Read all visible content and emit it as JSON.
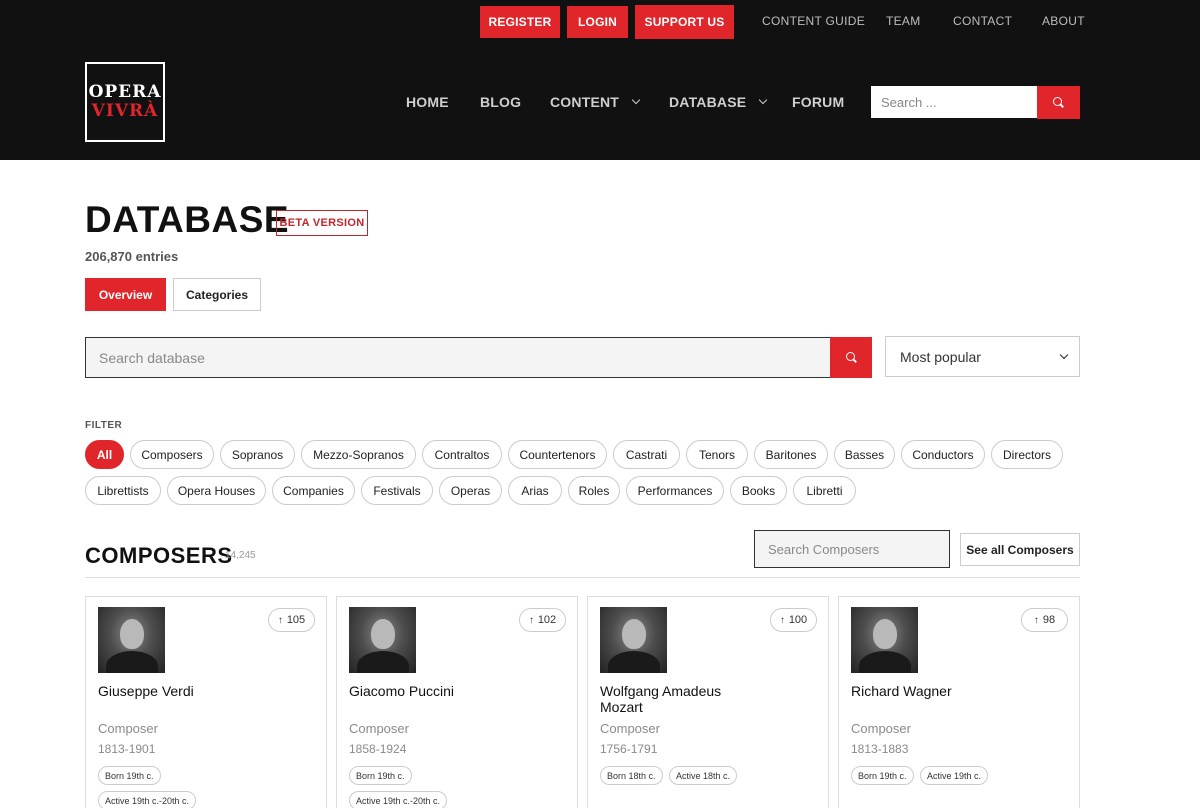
{
  "header": {
    "top_buttons": {
      "register": "REGISTER",
      "login": "LOGIN",
      "support": "SUPPORT US"
    },
    "top_links": {
      "content_guide": "CONTENT GUIDE",
      "team": "TEAM",
      "contact": "CONTACT",
      "about": "ABOUT"
    },
    "logo": {
      "line1": "OPERA",
      "line2": "VIVRÀ"
    },
    "nav": {
      "home": "HOME",
      "blog": "BLOG",
      "content": "CONTENT",
      "database": "DATABASE",
      "forum": "FORUM"
    },
    "search": {
      "placeholder": "Search ..."
    }
  },
  "page": {
    "title": "DATABASE",
    "badge": "BETA VERSION",
    "entries": "206,870 entries",
    "tabs": {
      "overview": "Overview",
      "categories": "Categories"
    },
    "search": {
      "placeholder": "Search database"
    },
    "sort": {
      "selected": "Most popular"
    },
    "filter_label": "FILTER",
    "filters": {
      "all": "All",
      "composers": "Composers",
      "sopranos": "Sopranos",
      "mezzo": "Mezzo-Sopranos",
      "contraltos": "Contraltos",
      "countertenors": "Countertenors",
      "castrati": "Castrati",
      "tenors": "Tenors",
      "baritones": "Baritones",
      "basses": "Basses",
      "conductors": "Conductors",
      "directors": "Directors",
      "librettists": "Librettists",
      "opera_houses": "Opera Houses",
      "companies": "Companies",
      "festivals": "Festivals",
      "operas": "Operas",
      "arias": "Arias",
      "roles": "Roles",
      "performances": "Performances",
      "books": "Books",
      "libretti": "Libretti"
    }
  },
  "composers": {
    "title": "COMPOSERS",
    "count": "14,245",
    "search_placeholder": "Search Composers",
    "see_all": "See all Composers",
    "cards": [
      {
        "name": "Giuseppe Verdi",
        "votes": "105",
        "role": "Composer",
        "dates": "1813-1901",
        "tags": [
          "Born 19th c.",
          "Active 19th c.-20th c."
        ]
      },
      {
        "name": "Giacomo Puccini",
        "votes": "102",
        "role": "Composer",
        "dates": "1858-1924",
        "tags": [
          "Born 19th c.",
          "Active 19th c.-20th c."
        ]
      },
      {
        "name": "Wolfgang Amadeus Mozart",
        "votes": "100",
        "role": "Composer",
        "dates": "1756-1791",
        "tags": [
          "Born 18th c.",
          "Active 18th c."
        ]
      },
      {
        "name": "Richard Wagner",
        "votes": "98",
        "role": "Composer",
        "dates": "1813-1883",
        "tags": [
          "Born 19th c.",
          "Active 19th c."
        ]
      }
    ]
  },
  "colors": {
    "accent": "#e0252b",
    "header_bg": "#111111",
    "muted_text": "#8a8a8a"
  }
}
